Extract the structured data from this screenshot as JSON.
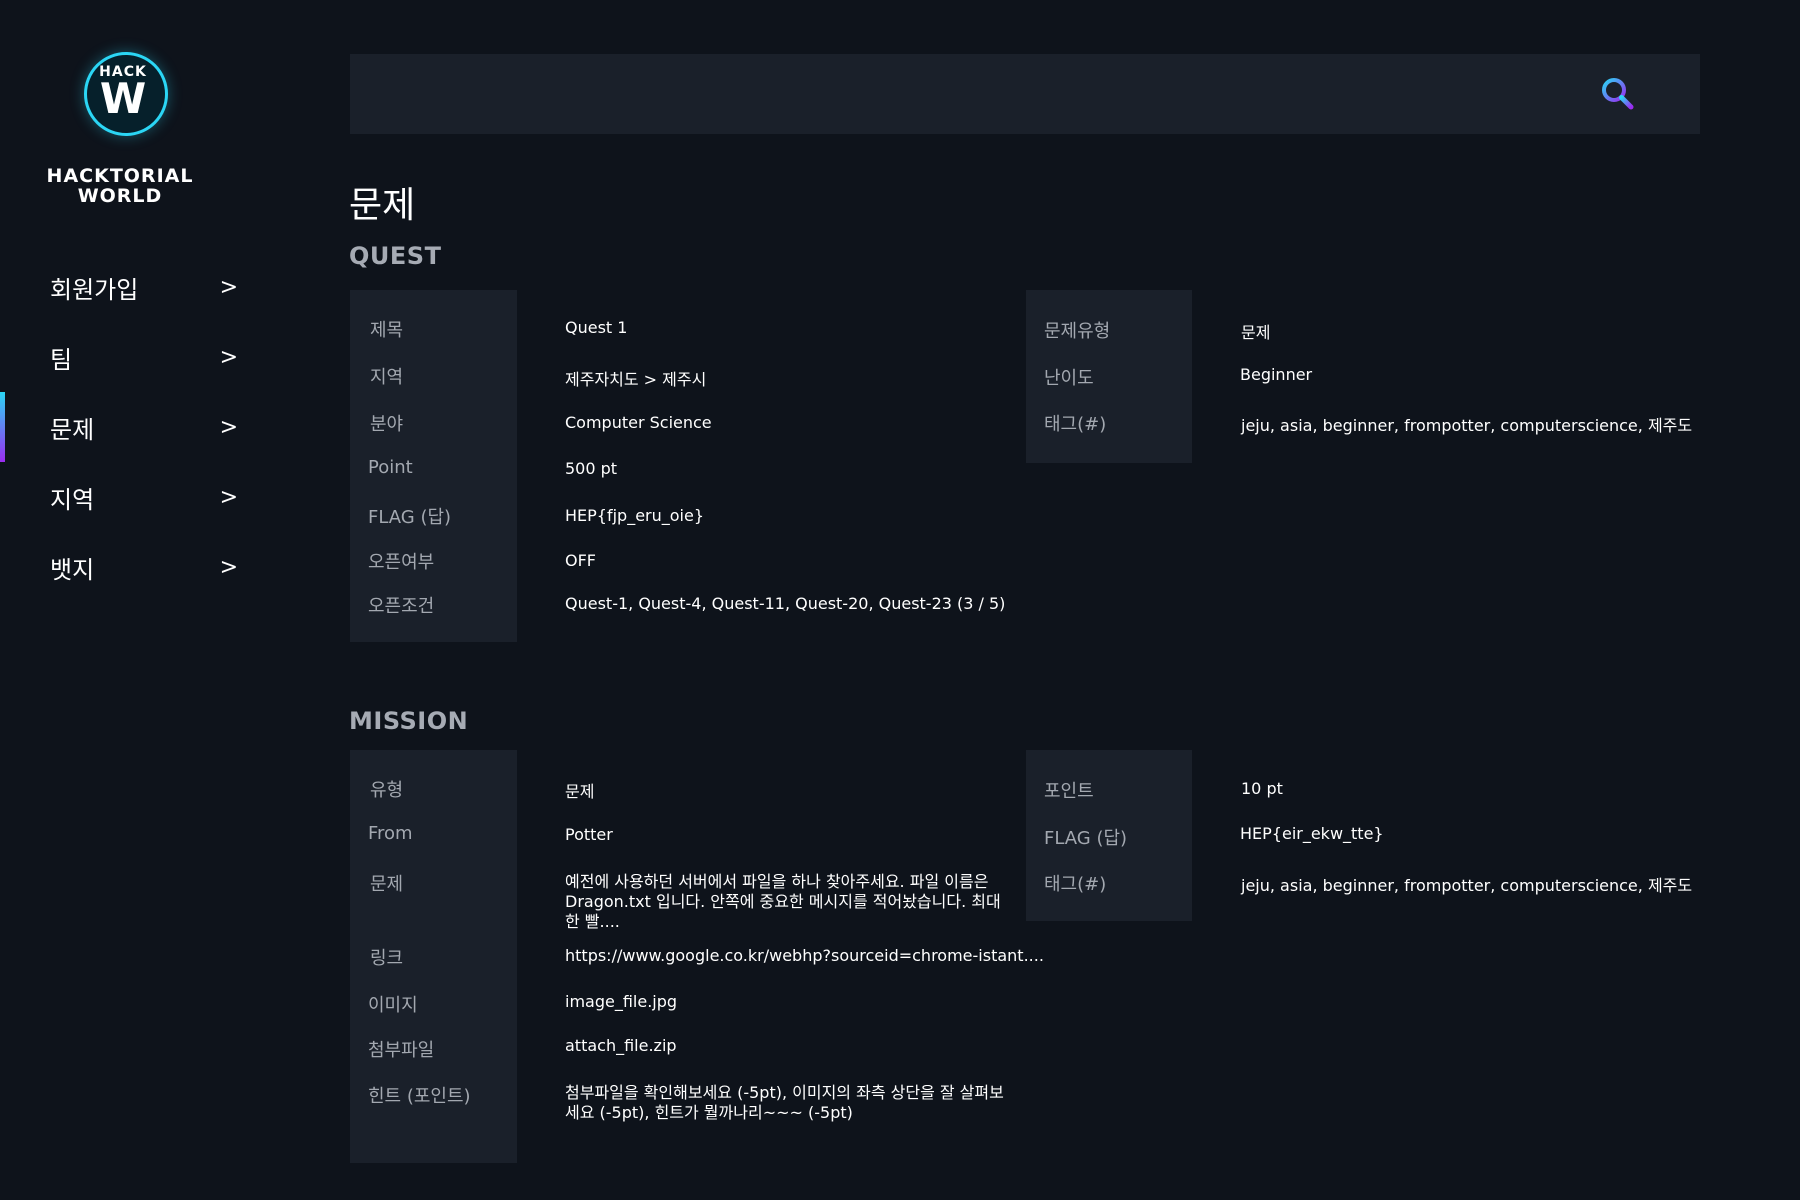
{
  "brand": {
    "logo_top": "HACK",
    "logo_letter": "W",
    "line1": "HACKTORIAL",
    "line2": "WORLD"
  },
  "nav": {
    "chevron": ">",
    "items": [
      {
        "label": "회원가입",
        "active": false
      },
      {
        "label": "팀",
        "active": false
      },
      {
        "label": "문제",
        "active": true
      },
      {
        "label": "지역",
        "active": false
      },
      {
        "label": "뱃지",
        "active": false
      }
    ]
  },
  "search": {
    "placeholder": "",
    "value": "",
    "icon": "search-icon"
  },
  "page": {
    "title": "문제"
  },
  "quest": {
    "heading": "QUEST",
    "left": [
      {
        "label": "제목",
        "value": "Quest 1"
      },
      {
        "label": "지역",
        "value": "제주자치도 > 제주시"
      },
      {
        "label": "분야",
        "value": "Computer Science"
      },
      {
        "label": "Point",
        "value": "500 pt"
      },
      {
        "label": "FLAG (답)",
        "value": "HEP{fjp_eru_oie}"
      },
      {
        "label": "오픈여부",
        "value": "OFF"
      },
      {
        "label": "오픈조건",
        "value": "Quest-1, Quest-4, Quest-11, Quest-20, Quest-23 (3 / 5)"
      }
    ],
    "right": [
      {
        "label": "문제유형",
        "value": "문제"
      },
      {
        "label": "난이도",
        "value": "Beginner"
      },
      {
        "label": "태그(#)",
        "value": "jeju, asia, beginner, frompotter, computerscience, 제주도"
      }
    ]
  },
  "mission": {
    "heading": "MISSION",
    "left": [
      {
        "label": "유형",
        "value": "문제"
      },
      {
        "label": "From",
        "value": "Potter"
      },
      {
        "label": "문제",
        "value": "예전에 사용하던 서버에서 파일을 하나 찾아주세요. 파일 이름은 Dragon.txt 입니다. 안쪽에 중요한 메시지를 적어놨습니다. 최대한 빨...."
      },
      {
        "label": "링크",
        "value": "https://www.google.co.kr/webhp?sourceid=chrome-istant...."
      },
      {
        "label": "이미지",
        "value": "image_file.jpg"
      },
      {
        "label": "첨부파일",
        "value": "attach_file.zip"
      },
      {
        "label": "힌트 (포인트)",
        "value": "첨부파일을 확인해보세요 (-5pt), 이미지의 좌측 상단을 잘 살펴보세요 (-5pt), 힌트가 뭘까나리~~~ (-5pt)"
      }
    ],
    "right": [
      {
        "label": "포인트",
        "value": "10 pt"
      },
      {
        "label": "FLAG (답)",
        "value": "HEP{eir_ekw_tte}"
      },
      {
        "label": "태그(#)",
        "value": "jeju, asia, beginner, frompotter, computerscience, 제주도"
      }
    ]
  },
  "colors": {
    "background": "#0e131b",
    "panel": "#1a202a",
    "accent_cyan": "#2bd6f5",
    "accent_purple": "#9a2cf0",
    "label_text": "#a3a8b0"
  }
}
